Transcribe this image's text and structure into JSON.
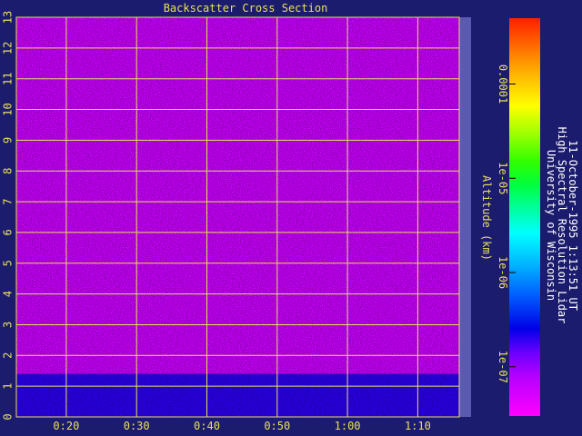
{
  "chart_data": {
    "type": "heatmap",
    "title": "Backscatter Cross Section",
    "ylabel": "Altitude (km)",
    "xlabel": "",
    "ylim": [
      0,
      13
    ],
    "y_ticks": [
      "0",
      "1",
      "2",
      "3",
      "4",
      "5",
      "6",
      "7",
      "8",
      "9",
      "10",
      "11",
      "12",
      "13"
    ],
    "x_ticks": [
      "0:20",
      "0:30",
      "0:40",
      "0:50",
      "1:00",
      "1:10"
    ],
    "grid": true,
    "colorbar": {
      "scale": "log",
      "range": [
        3e-08,
        0.0005
      ],
      "tick_labels": [
        "0.0001",
        "1e-05",
        "1e-06",
        "1e-07"
      ]
    },
    "layers": [
      {
        "from_km": 0,
        "to_km": 1.4,
        "value": 2e-07
      },
      {
        "from_km": 1.4,
        "to_km": 13,
        "value": 6e-08
      }
    ],
    "source": [
      "University of Wisconsin",
      "High Spectral Resolution Lidar",
      "11-October-1995  1:13:51 UT"
    ]
  },
  "colors": {
    "background": "#1c1c6e",
    "grid": "#e8e05a",
    "text": "#e8e05a",
    "credit_text": "#ffffff"
  }
}
